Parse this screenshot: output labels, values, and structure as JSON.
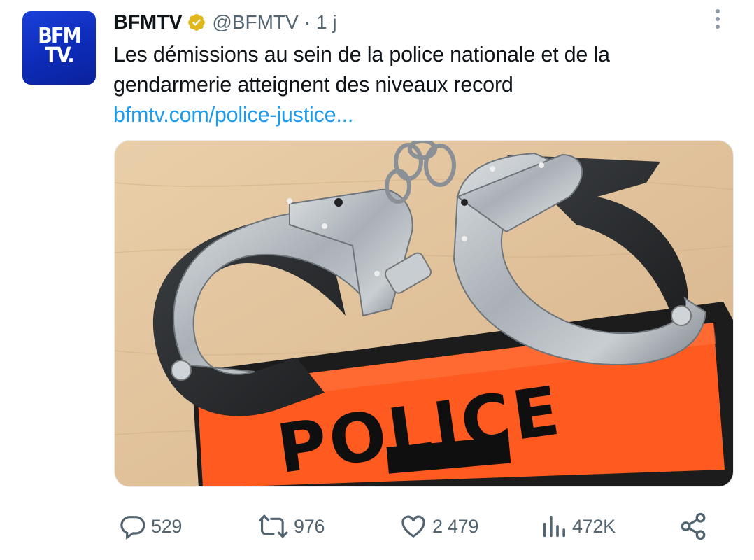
{
  "account": {
    "avatar_text_line1": "BFM",
    "avatar_text_line2": "TV.",
    "display_name": "BFMTV",
    "handle": "@BFMTV",
    "separator": "·",
    "time": "1 j",
    "verified_icon": "verified-badge-icon",
    "brand_color": "#1a3fd8"
  },
  "tweet": {
    "text": "Les démissions au sein de la police nationale et de la gendarmerie atteignent des niveaux record",
    "link": "bfmtv.com/police-justice...",
    "link_color": "#1d9bf0"
  },
  "media": {
    "armband_text": "POLICE",
    "armband_color": "#ff5a1f"
  },
  "actions": {
    "replies": "529",
    "reposts": "976",
    "likes": "2 479",
    "views": "472K",
    "icon_color": "#536471"
  }
}
